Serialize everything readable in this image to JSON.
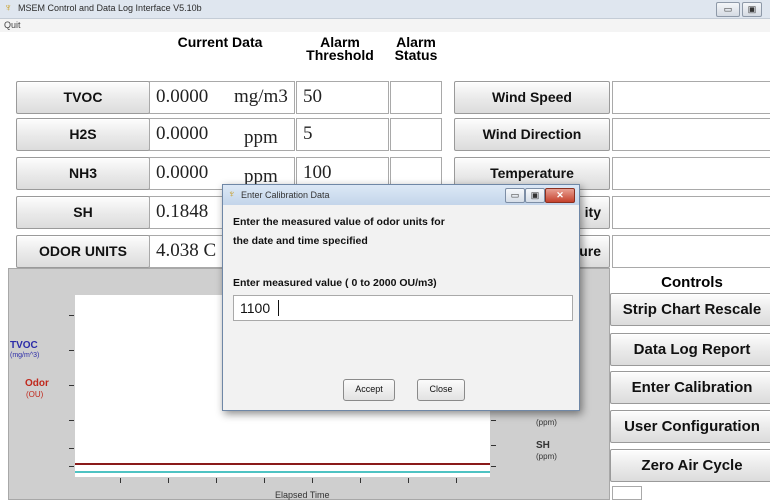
{
  "window": {
    "title": "MSEM Control and Data Log Interface V5.10b",
    "minimize_glyph": "▭",
    "maximize_glyph": "▣"
  },
  "menu": {
    "quit": "Quit"
  },
  "headers": {
    "current_data": "Current Data",
    "alarm_threshold": "Alarm Threshold",
    "alarm_status": "Alarm Status"
  },
  "sensors": [
    {
      "label": "TVOC",
      "value": "0.0000",
      "unit": "mg/m3",
      "threshold": "50"
    },
    {
      "label": "H2S",
      "value": "0.0000",
      "unit": "ppm",
      "threshold": "5"
    },
    {
      "label": "NH3",
      "value": "0.0000",
      "unit": "ppm",
      "threshold": "100"
    },
    {
      "label": "SH",
      "value": "0.1848",
      "unit": "",
      "threshold": ""
    },
    {
      "label": "ODOR UNITS",
      "value": "4.038 C",
      "unit": "",
      "threshold": ""
    }
  ],
  "weather": [
    {
      "label": "Wind Speed"
    },
    {
      "label": "Wind Direction"
    },
    {
      "label": "Temperature"
    },
    {
      "label": "ity"
    },
    {
      "label": "sure"
    }
  ],
  "controls": {
    "title": "Controls",
    "buttons": [
      "Strip Chart Rescale",
      "Data Log Report",
      "Enter Calibration",
      "User Configuration",
      "Zero Air Cycle"
    ]
  },
  "chart": {
    "left_labels": [
      {
        "name": "TVOC",
        "unit": "(mg/m^3)",
        "color": "#2c2ca8"
      },
      {
        "name": "Odor",
        "unit": "(OU)",
        "color": "#c0281c"
      }
    ],
    "right_labels": [
      {
        "name": "",
        "unit": "(ppm)"
      },
      {
        "name": "SH",
        "unit": "(ppm)"
      }
    ],
    "xlabel": "Elapsed Time",
    "line_colors": [
      "#8a1a1a",
      "#4fc3c3"
    ]
  },
  "dialog": {
    "title": "Enter Calibration Data",
    "message_line1": "Enter the measured value of odor units for",
    "message_line2": "the date and time specified",
    "prompt": "Enter measured value ( 0 to 2000 OU/m3)",
    "input_value": "1100",
    "accept": "Accept",
    "close": "Close",
    "close_glyph": "✕"
  }
}
